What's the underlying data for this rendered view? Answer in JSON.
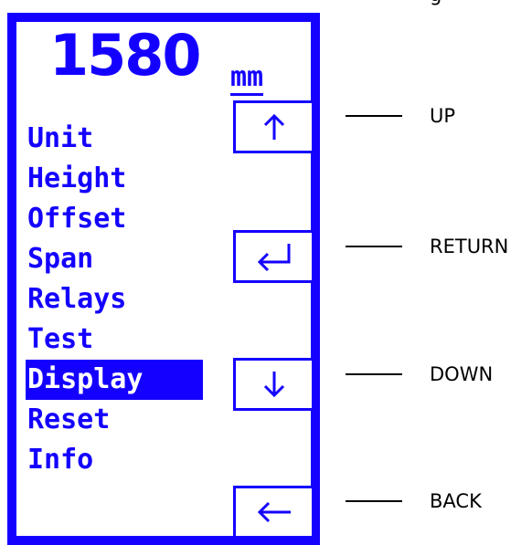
{
  "display": {
    "reading": "1580",
    "unit": "mm"
  },
  "menu": {
    "items": [
      {
        "label": "Unit",
        "selected": false
      },
      {
        "label": "Height",
        "selected": false
      },
      {
        "label": "Offset",
        "selected": false
      },
      {
        "label": "Span",
        "selected": false
      },
      {
        "label": "Relays",
        "selected": false
      },
      {
        "label": "Test",
        "selected": false
      },
      {
        "label": "Display",
        "selected": true
      },
      {
        "label": "Reset",
        "selected": false
      },
      {
        "label": "Info",
        "selected": false
      }
    ]
  },
  "keys": {
    "up": {
      "icon": "arrow-up-icon",
      "label": "UP"
    },
    "return": {
      "icon": "return-arrow-icon",
      "label": "RETURN"
    },
    "down": {
      "icon": "arrow-down-icon",
      "label": "DOWN"
    },
    "back": {
      "icon": "arrow-left-icon",
      "label": "BACK"
    }
  },
  "colors": {
    "frame": "#1400ff",
    "screen": "#ffffff",
    "callout_text": "#000000"
  }
}
